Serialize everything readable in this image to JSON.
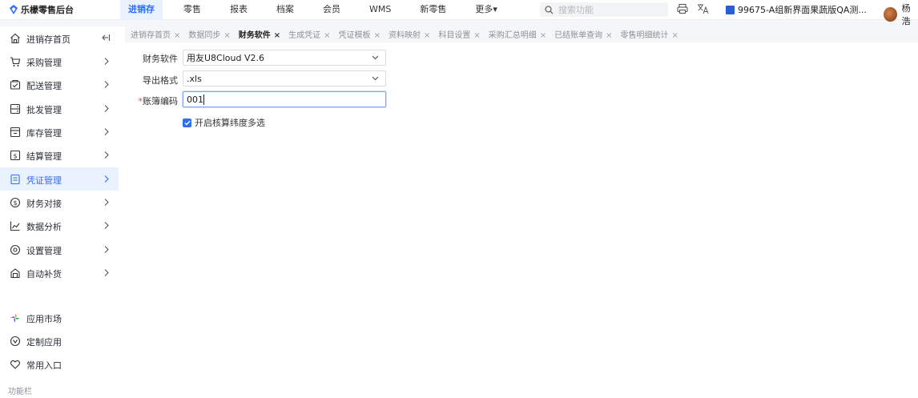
{
  "app": {
    "title": "乐檬零售后台"
  },
  "topnav": {
    "items": [
      {
        "label": "进销存",
        "active": true
      },
      {
        "label": "零售"
      },
      {
        "label": "报表"
      },
      {
        "label": "档案"
      },
      {
        "label": "会员"
      },
      {
        "label": "WMS"
      },
      {
        "label": "新零售"
      },
      {
        "label": "更多"
      }
    ],
    "search_placeholder": "搜索功能",
    "org": "99675-A组新界面果蔬版QA测...",
    "user": "杨浩"
  },
  "sidebar": {
    "items": [
      {
        "label": "进销存首页",
        "icon": "home-icon"
      },
      {
        "label": "采购管理",
        "icon": "cart-icon"
      },
      {
        "label": "配送管理",
        "icon": "delivery-icon"
      },
      {
        "label": "批发管理",
        "icon": "wholesale-icon"
      },
      {
        "label": "库存管理",
        "icon": "inventory-icon"
      },
      {
        "label": "结算管理",
        "icon": "settlement-icon"
      },
      {
        "label": "凭证管理",
        "icon": "voucher-icon",
        "active": true
      },
      {
        "label": "财务对接",
        "icon": "finance-icon"
      },
      {
        "label": "数据分析",
        "icon": "analytics-icon"
      },
      {
        "label": "设置管理",
        "icon": "settings-icon"
      },
      {
        "label": "自动补货",
        "icon": "replenish-icon"
      },
      {
        "label": "应用市场",
        "icon": "app-market-icon"
      },
      {
        "label": "定制应用",
        "icon": "custom-app-icon"
      },
      {
        "label": "常用入口",
        "icon": "heart-icon"
      }
    ],
    "footer": "功能栏"
  },
  "tabs": [
    {
      "label": "进销存首页"
    },
    {
      "label": "数据同步"
    },
    {
      "label": "财务软件",
      "active": true
    },
    {
      "label": "生成凭证"
    },
    {
      "label": "凭证模板"
    },
    {
      "label": "资料映射"
    },
    {
      "label": "科目设置"
    },
    {
      "label": "采购汇总明细"
    },
    {
      "label": "已结账单查询"
    },
    {
      "label": "零售明细统计"
    }
  ],
  "form": {
    "software_label": "财务软件",
    "software_value": "用友U8Cloud V2.6",
    "format_label": "导出格式",
    "format_value": ".xls",
    "account_label": "账簿编码",
    "account_value": "001",
    "multi_dimension_label": "开启核算纬度多选",
    "multi_dimension_checked": true
  },
  "colors": {
    "accent": "#2f6ff6",
    "required": "#e54545"
  }
}
